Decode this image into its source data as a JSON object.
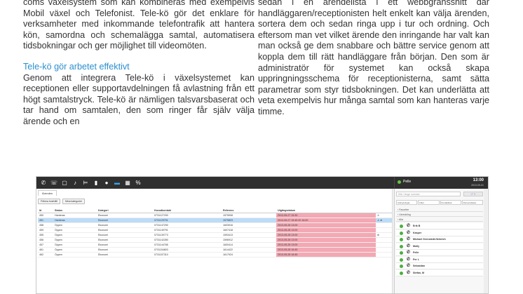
{
  "article": {
    "left_top": "coms växelsystem som kan kombineras med exempelvis Mobil växel och Telefonist. Tele-kö gör det enklare för verksamheter med inkommande telefontrafik att hantera kön, samordna och schemalägga samtal, automatisera tidsbokningar och ger möjlighet till videomöten.",
    "left_heading": "Tele-kö gör arbetet effektivt",
    "left_body": "Genom att integrera Tele-kö i växelsystemet kan receptionen eller supportavdelningen få avlastning från ett högt samtalstryck. Tele-kö är nämligen talsvarsbaserat och tar hand om samtalen, den som ringer får själv välja ärende och en",
    "right_body": "sedan i en ärendelista i ett webbgränssnitt där handläggaren/receptionisten helt enkelt kan välja ärenden, sortera dem och sedan ringa upp i tur och ordning. Och eftersom man vet vilket ärende den inringande har valt kan man också ge dem snabbare och bättre service genom att koppla dem till rätt handläggare från början. Den som är administratör för systemet kan också skapa uppringningsschema för receptionisterna, samt sätta parametrar som styr tidsbokningen. Det kan underlätta att veta exempelvis hur många samtal som kan hanteras varje timme."
  },
  "app": {
    "toolbar_icons": [
      "phone-icon",
      "queue-phone-icon",
      "window-icon",
      "microphone-icon",
      "bed-icon",
      "bar-chart-icon",
      "globe-icon",
      "briefcase-icon",
      "calendar-icon",
      "link-icon"
    ],
    "user": {
      "name": "Pelle",
      "time": "13:00",
      "date": "2013-09-01"
    },
    "tab": "Ärenden",
    "filters": [
      "Filtrera innehåll",
      "Mina kategorier"
    ],
    "columns": [
      "Id",
      "Status",
      "Kategori",
      "Huvudkontakt",
      "Referens",
      "Utgångsdatum",
      ""
    ],
    "rows": [
      {
        "id": "450",
        "status": "Hanteras",
        "cat": "Ekonomi",
        "contact": "0731127290",
        "ref": "1575908",
        "due": "2013-05-27 15:30",
        "flag": "♙",
        "style": "pink"
      },
      {
        "id": "451",
        "status": "Hanteras",
        "cat": "Ekonomi",
        "contact": "0731129791",
        "ref": "1579823",
        "due": "2013-05-27 15:45 00 16:00",
        "flag": "♙ ⊕",
        "style": "blue"
      },
      {
        "id": "458",
        "status": "Öppen",
        "cat": "Ekonomi",
        "contact": "0731147290",
        "ref": "1603916",
        "due": "2013-05-28 13:00",
        "flag": "",
        "style": "pink"
      },
      {
        "id": "459",
        "status": "Öppen",
        "cat": "Ekonomi",
        "contact": "0731149791",
        "ref": "1607418",
        "due": "2013-05-28 13:00",
        "flag": "",
        "style": "pink"
      },
      {
        "id": "455",
        "status": "Öppen",
        "cat": "Ekonomi",
        "contact": "0731139773",
        "ref": "1593413",
        "due": "2013-05-28 13:00",
        "flag": "⊕",
        "style": "pink"
      },
      {
        "id": "456",
        "status": "Öppen",
        "cat": "Ekonomi",
        "contact": "0731142280",
        "ref": "1596912",
        "due": "2013-05-28 13:00",
        "flag": "",
        "style": "pink"
      },
      {
        "id": "457",
        "status": "Öppen",
        "cat": "Ekonomi",
        "contact": "0731144785",
        "ref": "1600414",
        "due": "2013-05-28 13:00",
        "flag": "",
        "style": "pink"
      },
      {
        "id": "461",
        "status": "Öppen",
        "cat": "Ekonomi",
        "contact": "0731154803",
        "ref": "1614422",
        "due": "2013-05-28 16:45",
        "flag": "",
        "style": "pink"
      },
      {
        "id": "462",
        "status": "Öppen",
        "cat": "Ekonomi",
        "contact": "0731157310",
        "ref": "1617924",
        "due": "2013-05-28 16:45",
        "flag": "",
        "style": "pink"
      }
    ],
    "side": {
      "search_placeholder": "Sök / Ange nummer",
      "call_label": "↺ ↻",
      "tabs": [
        "Anknytningar",
        "Filter",
        "Kontaktbok",
        "Personsökare"
      ],
      "groups": [
        "Favoriter",
        "Utveckling",
        "Alla"
      ],
      "persons": [
        "Erik B",
        "Kasper",
        "Michael Grenstedt-Heinrich",
        "Molly",
        "Pelle",
        "Per L",
        "Sebastian",
        "Stefan, M"
      ]
    }
  }
}
